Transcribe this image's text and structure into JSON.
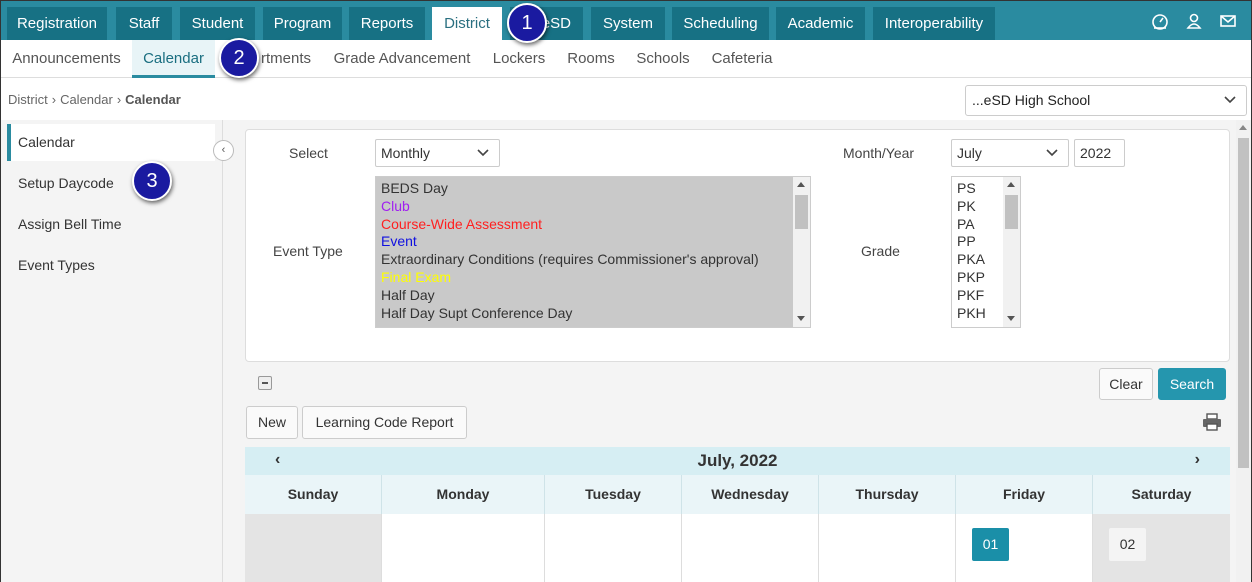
{
  "topnav": {
    "tabs": [
      {
        "label": "Registration"
      },
      {
        "label": "Staff"
      },
      {
        "label": "Student"
      },
      {
        "label": "Program"
      },
      {
        "label": "Reports"
      },
      {
        "label": "District"
      },
      {
        "label": "eSD"
      },
      {
        "label": "System"
      },
      {
        "label": "Scheduling"
      },
      {
        "label": "Academic"
      },
      {
        "label": "Interoperability"
      }
    ],
    "icons": [
      "dashboard-icon",
      "user-icon",
      "mail-icon"
    ]
  },
  "subnav": {
    "items": [
      {
        "label": "Announcements"
      },
      {
        "label": "Calendar"
      },
      {
        "label": "rtments"
      },
      {
        "label": "Grade Advancement"
      },
      {
        "label": "Lockers"
      },
      {
        "label": "Rooms"
      },
      {
        "label": "Schools"
      },
      {
        "label": "Cafeteria"
      }
    ]
  },
  "breadcrumb": {
    "items": [
      "District",
      "Calendar",
      "Calendar"
    ]
  },
  "school_selector": {
    "value": "...eSD High School"
  },
  "sidebar": {
    "items": [
      {
        "label": "Calendar"
      },
      {
        "label": "Setup Daycode"
      },
      {
        "label": "Assign Bell Time"
      },
      {
        "label": "Event Types"
      }
    ]
  },
  "filters": {
    "select_label": "Select",
    "select_value": "Monthly",
    "month_year_label": "Month/Year",
    "month_value": "July",
    "year_value": "2022",
    "event_type_label": "Event Type",
    "event_types": [
      {
        "label": "BEDS Day",
        "color": "#333333"
      },
      {
        "label": "Club",
        "color": "#a020f0"
      },
      {
        "label": "Course-Wide Assessment",
        "color": "#ff2020"
      },
      {
        "label": "Event",
        "color": "#1010e0"
      },
      {
        "label": "Extraordinary Conditions (requires Commissioner's approval)",
        "color": "#333333"
      },
      {
        "label": "Final Exam",
        "color": "#ffff00"
      },
      {
        "label": "Half Day",
        "color": "#333333"
      },
      {
        "label": "Half Day Supt Conference Day",
        "color": "#333333"
      }
    ],
    "grade_label": "Grade",
    "grades": [
      "PS",
      "PK",
      "PA",
      "PP",
      "PKA",
      "PKP",
      "PKF",
      "PKH"
    ],
    "clear_label": "Clear",
    "search_label": "Search"
  },
  "actions": {
    "new_label": "New",
    "report_label": "Learning Code Report"
  },
  "calendar": {
    "month_title": "July, 2022",
    "prev": "‹",
    "next": "›",
    "days": [
      "Sunday",
      "Monday",
      "Tuesday",
      "Wednesday",
      "Thursday",
      "Friday",
      "Saturday"
    ],
    "first_week": [
      "",
      "",
      "",
      "",
      "",
      "01",
      "02"
    ]
  },
  "callouts": [
    "1",
    "2",
    "3"
  ],
  "colors": {
    "accent": "#2a8ba0",
    "nav_tab": "#177184",
    "today": "#1a8fa8",
    "callout": "#1a1aa0"
  }
}
